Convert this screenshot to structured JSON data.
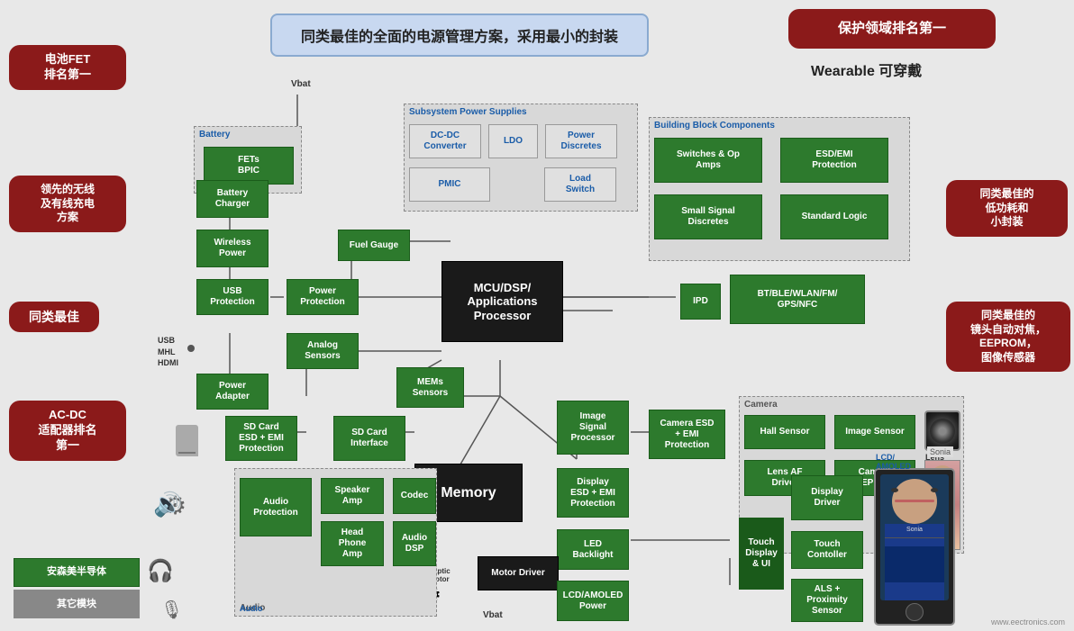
{
  "title": "同类最佳的全面的电源管理方案，采用最小的封装",
  "callouts": {
    "battery_fet": "电池FET\n排名第一",
    "wireless_wired": "领先的无线\n及有线充电\n方案",
    "best_in_class": "同类最佳",
    "ac_dc": "AC-DC\n适配器排名\n第一",
    "protection": "保护领域排名第一",
    "wearable": "Wearable  可穿戴",
    "low_power": "同类最佳的\n低功耗和\n小封装",
    "camera": "同类最佳的\n镜头自动对焦，\nEEPROM，\n图像传感器"
  },
  "components": {
    "battery": "Battery",
    "fets_bpic": "FETs\nBPIC",
    "battery_charger": "Battery\nCharger",
    "wireless_power": "Wireless\nPower",
    "usb_protection": "USB\nProtection",
    "power_protection": "Power\nProtection",
    "analog_sensors": "Analog\nSensors",
    "mems_sensors": "MEMs\nSensors",
    "power_adapter": "Power\nAdapter",
    "sd_card_esd": "SD Card\nESD + EMI\nProtection",
    "sd_card_interface": "SD Card\nInterface",
    "audio_protection": "Audio\nProtection",
    "speaker_amp": "Speaker\nAmp",
    "codec": "Codec",
    "head_phone_amp": "Head\nPhone\nAmp",
    "audio_dsp": "Audio DSP",
    "fuel_gauge": "Fuel Gauge",
    "memory": "Memory",
    "display_esd": "Display\nESD + EMI\nProtection",
    "led_backlight": "LED\nBacklight",
    "motor_driver": "Motor Driver",
    "lcd_amoled": "LCD/AMOLED\nPower",
    "image_signal": "Image\nSignal\nProcessor",
    "camera_esd": "Camera ESD\n+ EMI\nProtection",
    "display_driver": "Display\nDriver",
    "touch_controller": "Touch\nContoller",
    "als_proximity": "ALS +\nProximity\nSensor",
    "hall_sensor": "Hall Sensor",
    "image_sensor": "Image Sensor",
    "lens_af": "Lens AF\nDriver",
    "camera_eeprom": "Camera\nEEPROM",
    "ipd": "IPD",
    "bt_ble": "BT/BLE/WLAN/FM/\nGPS/NFC",
    "switches_op": "Switches & Op\nAmps",
    "esd_emi": "ESD/EMI\nProtection",
    "small_signal": "Small Signal\nDiscretes",
    "standard_logic": "Standard Logic",
    "mcu_dsp": "MCU/DSP/\nApplications\nProcessor",
    "haptic_motor": "Haptic\nMotor",
    "touch_display": "Touch\nDisplay\n& UI",
    "lcd_amoled_screen": "LCD/\nAMOLED"
  },
  "subsystem_labels": {
    "subsystem_power": "Subsystem Power Supplies",
    "building_block": "Building Block Components",
    "battery_section": "Battery",
    "camera_section": "Camera",
    "audio_section": "Audio"
  },
  "sub_components": {
    "dc_dc": "DC-DC\nConverter",
    "ldo": "LDO",
    "power_discretes": "Power\nDiscretes",
    "pmic": "PMIC",
    "load_switch": "Load\nSwitch"
  },
  "labels": {
    "vbat_top": "Vbat",
    "vbat_bottom": "Vbat",
    "usb": "USB",
    "mhl": "MHL",
    "hdmi": "HDMI",
    "lens": "Lens",
    "onsemi": "安森美半导体",
    "other_modules": "其它模块",
    "website": "www.eectronics.com"
  }
}
